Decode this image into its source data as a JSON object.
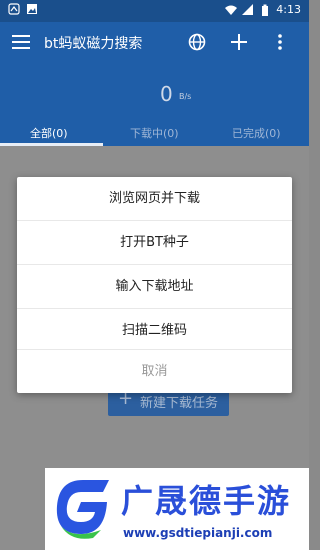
{
  "status_bar": {
    "time": "4:13",
    "colors": {
      "bg": "#1a4f8c"
    },
    "icons": [
      "notification-icon",
      "image-icon",
      "wifi-icon",
      "signal-icon",
      "battery-icon"
    ]
  },
  "app_bar": {
    "title": "bt蚂蚁磁力搜索",
    "icons": [
      "menu-icon",
      "globe-icon",
      "plus-icon",
      "more-icon"
    ],
    "colors": {
      "bg": "#1f5ea8"
    }
  },
  "speed": {
    "value": "0",
    "unit": "B/s"
  },
  "tabs": [
    {
      "label": "全部(0)",
      "active": true
    },
    {
      "label": "下载中(0)",
      "active": false
    },
    {
      "label": "已完成(0)",
      "active": false
    }
  ],
  "new_task_button": {
    "label": "新建下载任务"
  },
  "dialog": {
    "items": [
      {
        "label": "浏览网页并下载"
      },
      {
        "label": "打开BT种子"
      },
      {
        "label": "输入下载地址"
      },
      {
        "label": "扫描二维码"
      },
      {
        "label": "取消"
      }
    ]
  },
  "watermark": {
    "title": "广晟德手游",
    "url": "www.gsdtiepianji.com"
  }
}
